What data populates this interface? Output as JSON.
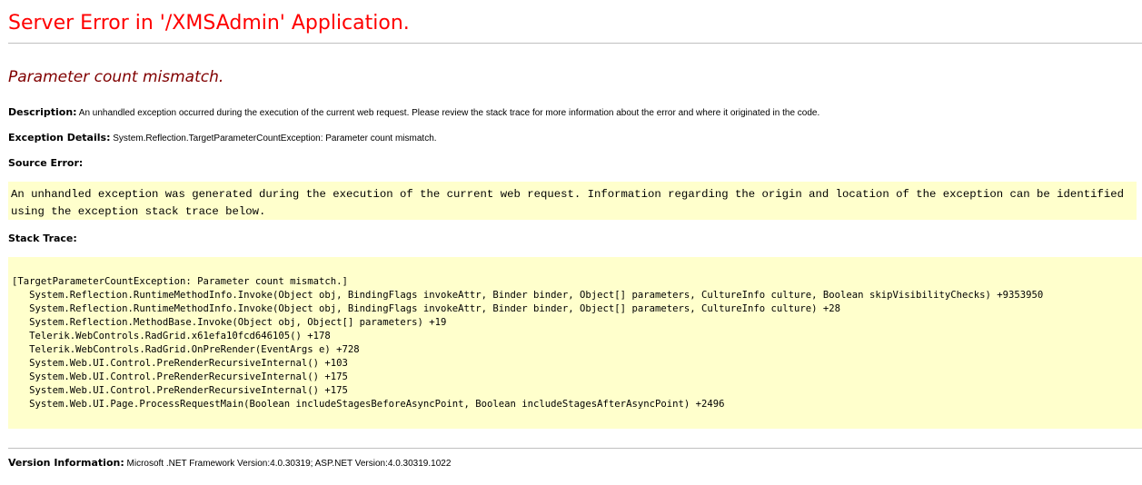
{
  "header": {
    "title": "Server Error in '/XMSAdmin' Application."
  },
  "error": {
    "message": "Parameter count mismatch.",
    "description_label": "Description:",
    "description_text": " An unhandled exception occurred during the execution of the current web request. Please review the stack trace for more information about the error and where it originated in the code.",
    "exception_label": "Exception Details:",
    "exception_text": " System.Reflection.TargetParameterCountException: Parameter count mismatch."
  },
  "source_error": {
    "label": "Source Error:",
    "text": "An unhandled exception was generated during the execution of the current web request. Information regarding the origin and location of the exception can be identified using the exception stack trace below."
  },
  "stack_trace": {
    "label": "Stack Trace:",
    "lines": [
      "[TargetParameterCountException: Parameter count mismatch.]",
      "   System.Reflection.RuntimeMethodInfo.Invoke(Object obj, BindingFlags invokeAttr, Binder binder, Object[] parameters, CultureInfo culture, Boolean skipVisibilityChecks) +9353950",
      "   System.Reflection.RuntimeMethodInfo.Invoke(Object obj, BindingFlags invokeAttr, Binder binder, Object[] parameters, CultureInfo culture) +28",
      "   System.Reflection.MethodBase.Invoke(Object obj, Object[] parameters) +19",
      "   Telerik.WebControls.RadGrid.x61efa10fcd646105() +178",
      "   Telerik.WebControls.RadGrid.OnPreRender(EventArgs e) +728",
      "   System.Web.UI.Control.PreRenderRecursiveInternal() +103",
      "   System.Web.UI.Control.PreRenderRecursiveInternal() +175",
      "   System.Web.UI.Control.PreRenderRecursiveInternal() +175",
      "   System.Web.UI.Page.ProcessRequestMain(Boolean includeStagesBeforeAsyncPoint, Boolean includeStagesAfterAsyncPoint) +2496"
    ]
  },
  "version": {
    "label": "Version Information:",
    "text": " Microsoft .NET Framework Version:4.0.30319; ASP.NET Version:4.0.30319.1022"
  },
  "colors": {
    "title": "#ff0000",
    "message": "#800000",
    "box_background": "#ffffcc",
    "rule": "#c0c0c0"
  }
}
